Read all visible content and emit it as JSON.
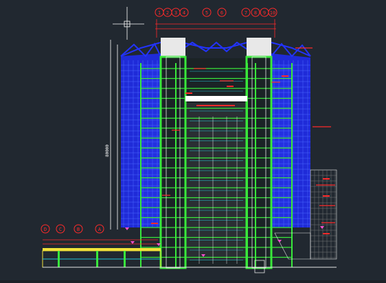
{
  "drawing": {
    "background": "#212830",
    "colors": {
      "structure_green": "#39e83b",
      "facade_blue": "#1f2bd8",
      "facade_grid": "#4d6bff",
      "annotation_red": "#ff2a2a",
      "core_white": "#e8e8e8",
      "slab_cyan": "#22c6d8",
      "pink": "#ff4fcf",
      "yellow": "#f2e23a"
    },
    "grid_labels_top": [
      "1",
      "2",
      "3",
      "4",
      "5",
      "6",
      "7",
      "8",
      "9",
      "10"
    ],
    "grid_labels_bottom": [
      "D",
      "C",
      "B",
      "A"
    ],
    "dimension_label": "80000",
    "symbols": [
      "crosshair-icon",
      "grid-bubble-icon",
      "level-marker-icon"
    ]
  }
}
